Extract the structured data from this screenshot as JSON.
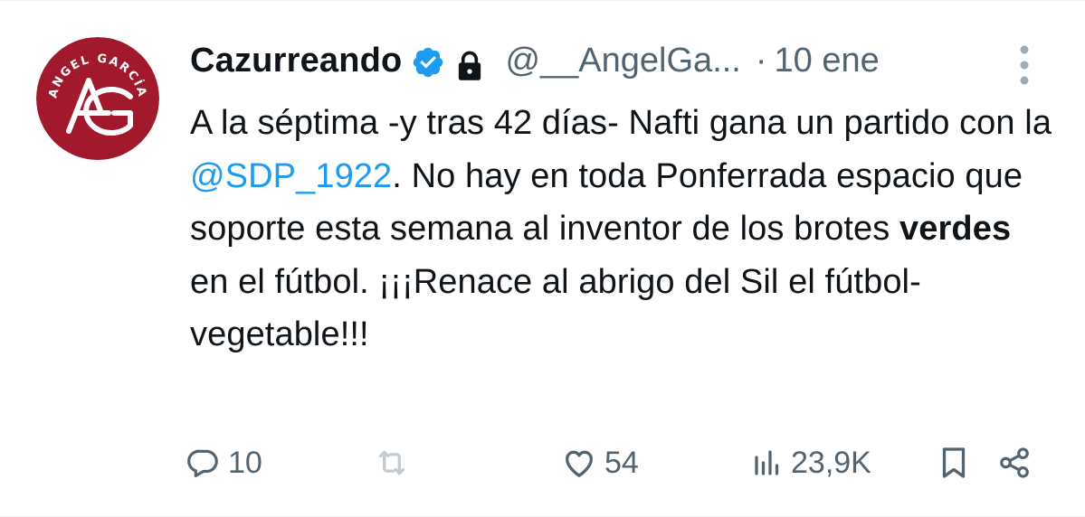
{
  "tweet": {
    "display_name": "Cazurreando",
    "handle": "@__AngelGa...",
    "separator": "·",
    "time": "10 ene",
    "avatar": {
      "text": "ANGEL GARCÍA",
      "monogram": "AG",
      "bg_color": "#a2192e"
    },
    "body": {
      "p1": "A la séptima -y tras 42 días- Nafti gana un partido con la ",
      "mention": "@SDP_1922",
      "p2": ". No hay en toda Ponferrada espacio que soporte esta semana al inventor de los brotes ",
      "bold": "verdes",
      "p3": " en el fútbol. ¡¡¡Renace al abrigo del Sil el fútbol-vegetable!!!"
    },
    "actions": {
      "reply_count": "10",
      "retweet_count": "",
      "like_count": "54",
      "views_count": "23,9K"
    },
    "colors": {
      "text": "#0f1419",
      "secondary": "#536471",
      "link": "#1d9bf0",
      "verified": "#1d9bf0"
    },
    "icons": {
      "verified": "verified-badge-icon",
      "lock": "lock-icon",
      "more": "more-vertical-icon",
      "reply": "reply-icon",
      "retweet": "retweet-icon",
      "like": "heart-icon",
      "views": "views-chart-icon",
      "bookmark": "bookmark-icon",
      "share": "share-icon"
    }
  }
}
